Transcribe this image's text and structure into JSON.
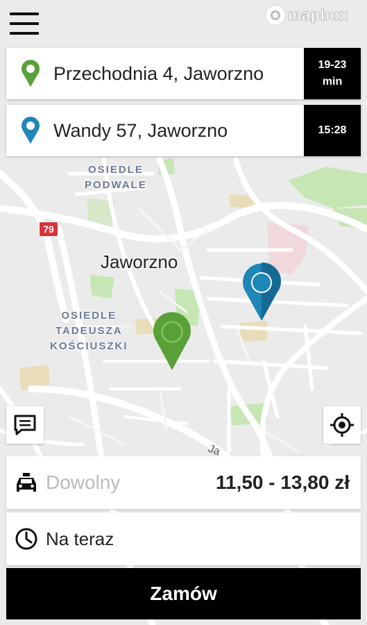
{
  "map": {
    "attribution_logo": "mapbox",
    "city_label": "Jaworzno",
    "districts": [
      {
        "line1": "OSIEDLE",
        "line2": "PODWALE"
      },
      {
        "line1": "OSIEDLE",
        "line2": "TADEUSZA",
        "line3": "KOŚCIUSZKI"
      }
    ],
    "road_shield": "79",
    "street_fragment": "Ja"
  },
  "route": {
    "pickup": {
      "address": "Przechodnia 4, Jaworzno",
      "eta_line1": "19-23",
      "eta_line2": "min",
      "pin_color": "#5aa03a"
    },
    "destination": {
      "address": "Wandy 57, Jaworzno",
      "time": "15:28",
      "pin_color": "#1f86b8"
    }
  },
  "order": {
    "car_type": "Dowolny",
    "price": "11,50 - 13,80 zł",
    "when": "Na teraz",
    "button_label": "Zamów"
  },
  "icons": [
    "menu-icon",
    "mapbox-logo-icon",
    "pin-icon",
    "chat-icon",
    "locate-icon",
    "taxi-icon",
    "clock-icon"
  ]
}
